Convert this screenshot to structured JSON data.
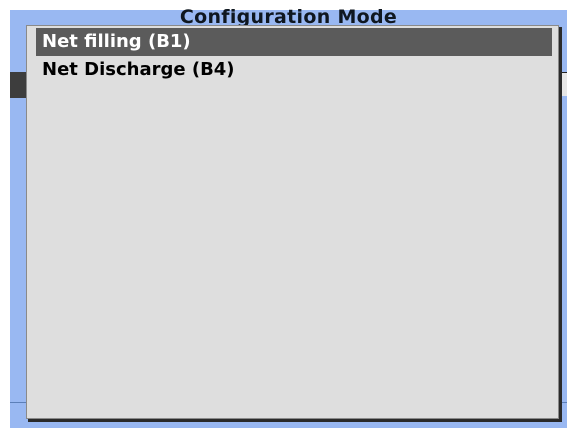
{
  "window": {
    "title": "Configuration Mode"
  },
  "dropdown": {
    "items": [
      {
        "label": "Net filling (B1)",
        "selected": true
      },
      {
        "label": "Net Discharge (B4)",
        "selected": false
      }
    ]
  },
  "colors": {
    "window_background": "#99b8f2",
    "popup_background": "#dedede",
    "selection_background": "#5b5b5b",
    "selection_text": "#ffffff"
  }
}
